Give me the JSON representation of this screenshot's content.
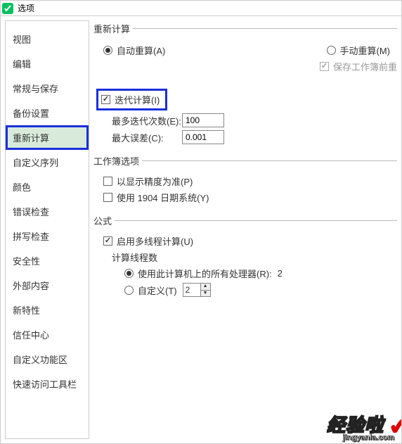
{
  "title": "选项",
  "sidebar": {
    "items": [
      {
        "label": "视图"
      },
      {
        "label": "编辑"
      },
      {
        "label": "常规与保存"
      },
      {
        "label": "备份设置"
      },
      {
        "label": "重新计算"
      },
      {
        "label": "自定义序列"
      },
      {
        "label": "颜色"
      },
      {
        "label": "错误检查"
      },
      {
        "label": "拼写检查"
      },
      {
        "label": "安全性"
      },
      {
        "label": "外部内容"
      },
      {
        "label": "新特性"
      },
      {
        "label": "信任中心"
      },
      {
        "label": "自定义功能区"
      },
      {
        "label": "快速访问工具栏"
      }
    ],
    "activeIndex": 4
  },
  "recalc": {
    "legend": "重新计算",
    "auto_label": "自动重算(A)",
    "manual_label": "手动重算(M)",
    "save_before_label": "保存工作簿前重",
    "iterate_label": "迭代计算(I)",
    "max_iter_label": "最多迭代次数(E):",
    "max_iter_value": "100",
    "max_diff_label": "最大误差(C):",
    "max_diff_value": "0.001"
  },
  "workbook": {
    "legend": "工作簿选项",
    "precision_label": "以显示精度为准(P)",
    "date1904_label": "使用 1904 日期系统(Y)"
  },
  "formula": {
    "legend": "公式",
    "multithread_label": "启用多线程计算(U)",
    "thread_count_legend": "计算线程数",
    "use_all_label": "使用此计算机上的所有处理器(R):",
    "use_all_count": "2",
    "custom_label": "自定义(T)",
    "custom_value": "2"
  },
  "watermark": {
    "line1": "经验啦",
    "line2": "jingyanla.com"
  }
}
